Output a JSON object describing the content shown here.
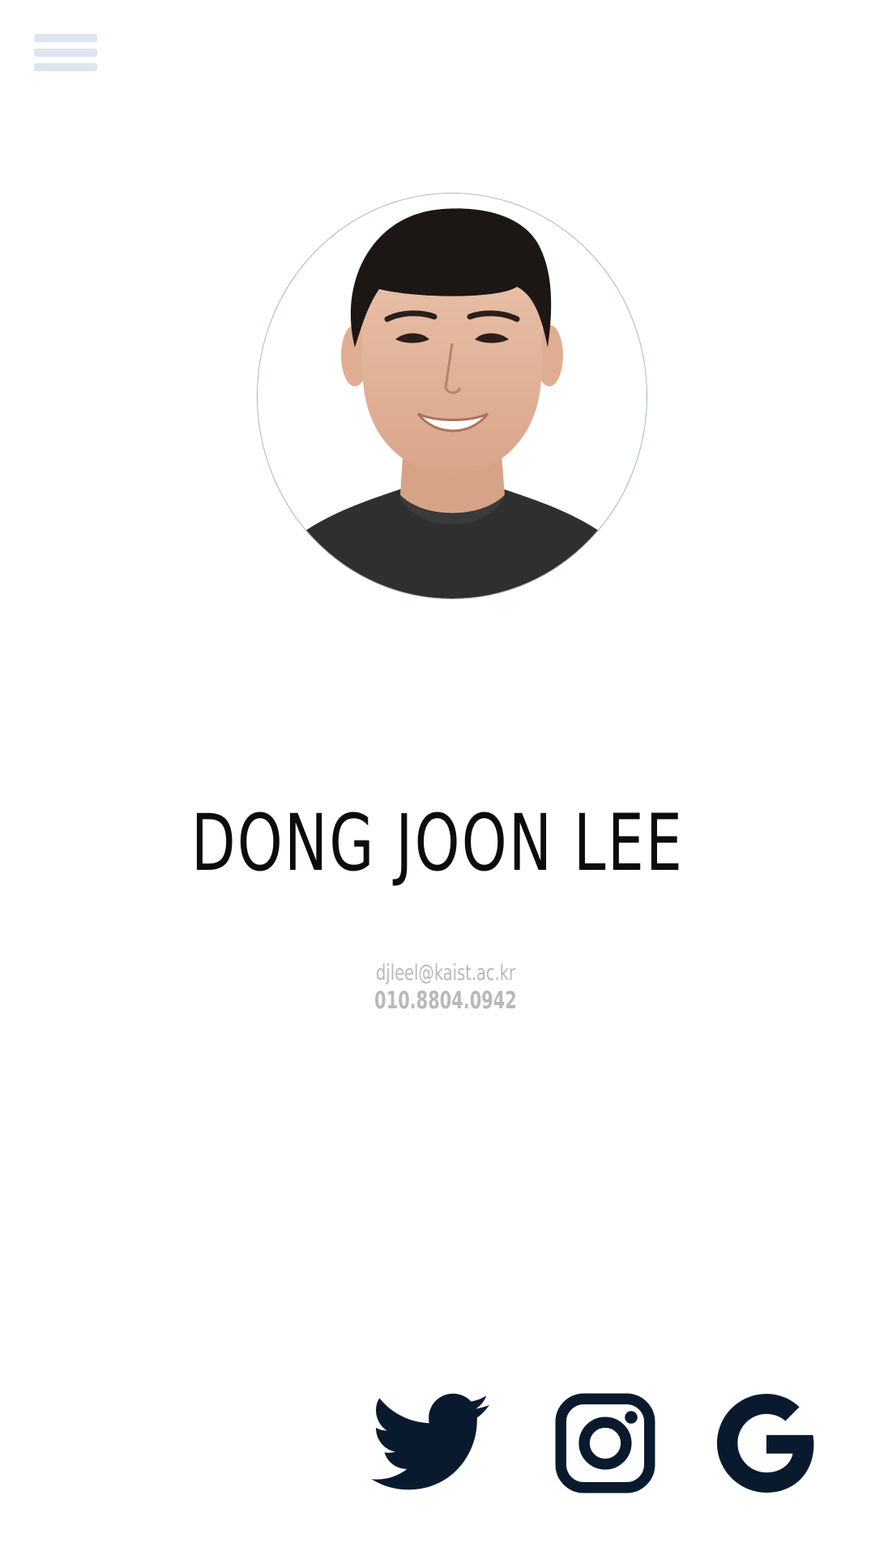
{
  "profile": {
    "name": "DONG JOON LEE",
    "email": "djleel@kaist.ac.kr",
    "phone": "010.8804.0942"
  },
  "menu": {
    "icon": "hamburger-menu-icon"
  },
  "avatar": {
    "description_icon": "profile-photo"
  },
  "social": {
    "items": [
      {
        "icon": "twitter-icon"
      },
      {
        "icon": "instagram-icon"
      },
      {
        "icon": "google-icon"
      }
    ]
  },
  "colors": {
    "background": "#ffffff",
    "menu_bar": "#dde6ee",
    "name_text": "#0c0c0c",
    "contact_text": "#b9b9b9",
    "icon": "#0a1a2e"
  }
}
